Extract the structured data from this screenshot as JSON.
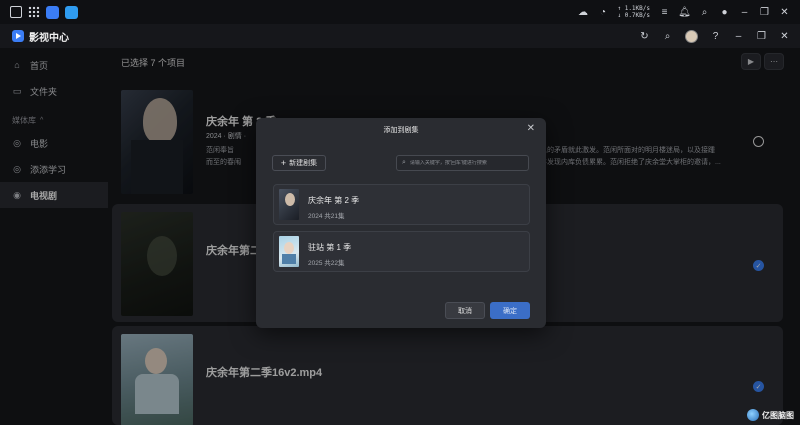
{
  "sysbar": {
    "net_up": "↑ 1.1KB/s",
    "net_down": "↓ 0.7KB/s"
  },
  "app": {
    "title": "影视中心"
  },
  "sidebar": {
    "items": [
      {
        "label": "首页",
        "icon": "home-icon"
      },
      {
        "label": "文件夹",
        "icon": "folder-icon"
      }
    ],
    "section": "媒体库",
    "library": [
      {
        "label": "电影",
        "icon": "movie-icon",
        "active": false
      },
      {
        "label": "添添学习",
        "icon": "study-icon",
        "active": false
      },
      {
        "label": "电视剧",
        "icon": "tv-icon",
        "active": true
      }
    ]
  },
  "main": {
    "selected_text": "已选择 7 个项目",
    "rows": [
      {
        "title": "庆余年 第 2 季",
        "meta": "2024 · 剧情 ·",
        "desc_line1": "范闲奉旨",
        "desc_line1b": "人的矛盾就此激发。范闲所面对的明月楼迷局，以及接踵",
        "desc_line2": "而至的春闱",
        "desc_line2b": "并发现内库负债累累。范闲拒绝了庆余堂大掌柜的邀请，...",
        "checked": false
      },
      {
        "title": "庆余年第二",
        "checked": true
      },
      {
        "title": "庆余年第二季16v2.mp4",
        "checked": true
      }
    ]
  },
  "modal": {
    "title": "添加到剧集",
    "new_button": "新建剧集",
    "search_placeholder": "请输入关键字，按'回车'键进行搜索",
    "series": [
      {
        "name": "庆余年 第 2 季",
        "meta": "2024   共21集"
      },
      {
        "name": "驻站 第 1 季",
        "meta": "2025   共22集"
      }
    ],
    "cancel": "取消",
    "confirm": "确定"
  },
  "watermark": {
    "text": "亿图脑图"
  },
  "colors": {
    "accent": "#3b82f6",
    "background": "#16171b",
    "modal": "#2a2c31"
  }
}
